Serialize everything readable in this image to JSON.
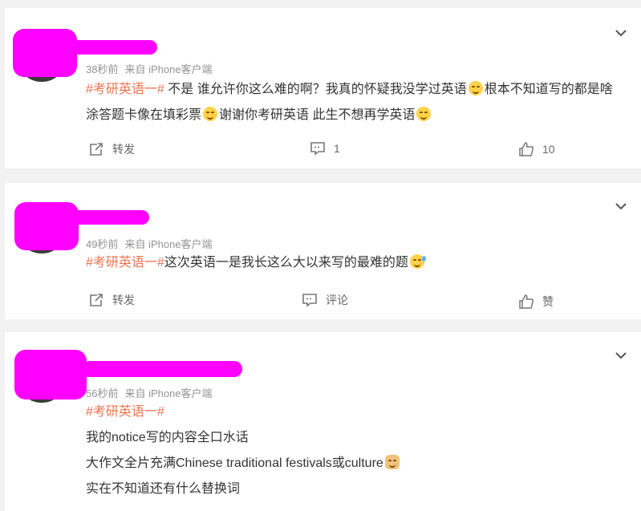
{
  "posts": [
    {
      "name": "",
      "time": "38秒前",
      "source": "来自 iPhone客户端",
      "tag": "#考研英语一#",
      "text_parts": [
        " 不是 谁允许你这么难的啊？我真的怀疑我没学过英语",
        "根本不知道写的都是啥 涂答题卡像在填彩票",
        "谢谢你考研英语 此生不想再学英语"
      ],
      "actions": {
        "repost": "转发",
        "comment": "1",
        "like": "10"
      }
    },
    {
      "name": "",
      "time": "49秒前",
      "source": "来自 iPhone客户端",
      "tag": "#考研英语一#",
      "text": "这次英语一是我长这么大以来写的最难的题",
      "actions": {
        "repost": "转发",
        "comment": "评论",
        "like": "赞"
      }
    },
    {
      "name": "",
      "time": "56秒前",
      "source": "来自 iPhone客户端",
      "tag": "#考研英语一#",
      "lines": [
        "我的notice写的内容全口水话",
        "大作文全片充满Chinese traditional festivals或culture",
        "实在不知道还有什么替换词"
      ]
    }
  ],
  "icons": {
    "repost": "repost-icon",
    "comment": "comment-icon",
    "like": "thumbs-up-icon",
    "expand": "chevron-down-icon",
    "emoji_smile": "smile-emoji-icon",
    "emoji_sweat": "sweat-emoji-icon",
    "emoji_doge": "doge-emoji-icon"
  },
  "colors": {
    "tag": "#eb7350",
    "meta": "#939393",
    "redaction": "#ff00ff",
    "background": "#f2f2f2"
  }
}
